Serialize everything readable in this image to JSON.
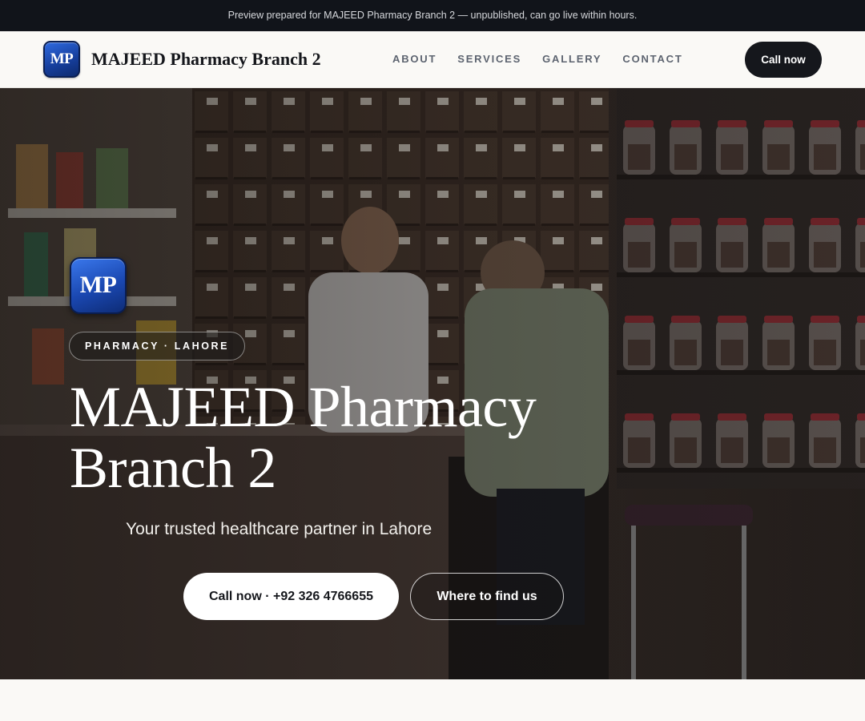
{
  "announcement": "Preview prepared for MAJEED Pharmacy Branch 2 — unpublished, can go live within hours.",
  "header": {
    "logo_text": "MP",
    "brand_name": "MAJEED Pharmacy Branch 2",
    "nav": [
      "ABOUT",
      "SERVICES",
      "GALLERY",
      "CONTACT"
    ],
    "cta_label": "Call now"
  },
  "hero": {
    "logo_text": "MP",
    "badge": "PHARMACY · LAHORE",
    "title": "MAJEED Pharmacy Branch 2",
    "tagline": "Your trusted healthcare partner in Lahore",
    "primary_button": "Call now · +92 326 4766655",
    "secondary_button": "Where to find us"
  },
  "colors": {
    "dark": "#15171c",
    "topbar": "#11141a",
    "page_background": "#faf9f6",
    "logo_blue": "#1a47b0"
  }
}
